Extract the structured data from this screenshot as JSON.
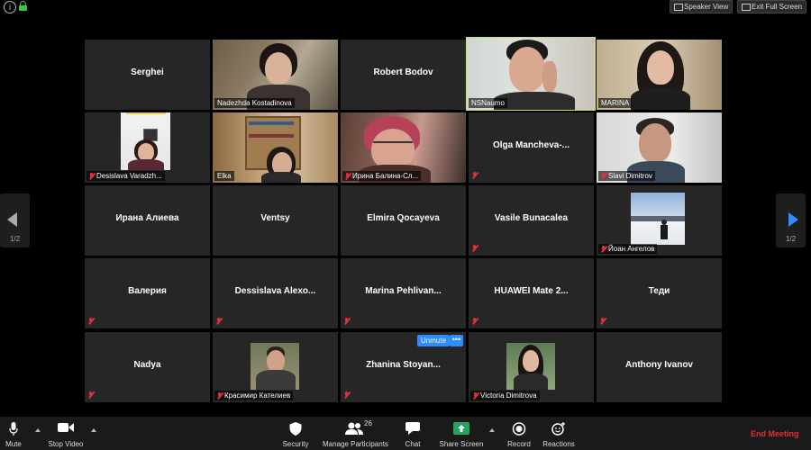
{
  "top_bar": {
    "speaker_view_label": "Speaker View",
    "exit_full_screen_label": "Exit Full Screen"
  },
  "pagination": {
    "left_page": "1/2",
    "right_page": "1/2"
  },
  "tiles": [
    {
      "name": "Serghei",
      "muted": false,
      "video": false
    },
    {
      "name": "Nadezhda Kostadinova",
      "muted": false,
      "video": true
    },
    {
      "name": "Robert Bodov",
      "muted": false,
      "video": false
    },
    {
      "name": "NSNaumo",
      "muted": false,
      "video": true,
      "active_speaker": true
    },
    {
      "name": "MARINA",
      "muted": false,
      "video": true
    },
    {
      "name": "Desislava Varadzh...",
      "muted": true,
      "video": false,
      "photo": true
    },
    {
      "name": "Elka",
      "muted": false,
      "video": true
    },
    {
      "name": "Ирина Балина-Сл...",
      "muted": true,
      "video": true
    },
    {
      "name": "Olga  Mancheva-...",
      "muted": true,
      "video": false
    },
    {
      "name": "Slavi Dimitrov",
      "muted": true,
      "video": true
    },
    {
      "name": "Ирана Алиева",
      "muted": false,
      "video": false
    },
    {
      "name": "Ventsy",
      "muted": false,
      "video": false
    },
    {
      "name": "Elmira Qocayeva",
      "muted": false,
      "video": false
    },
    {
      "name": "Vasile Bunacalea",
      "muted": true,
      "video": false
    },
    {
      "name": "Йоан Ангелов",
      "muted": true,
      "video": false,
      "photo": true
    },
    {
      "name": "Валерия",
      "muted": true,
      "video": false
    },
    {
      "name": "Dessislava  Alexo...",
      "muted": true,
      "video": false
    },
    {
      "name": "Marina  Pehlivan...",
      "muted": true,
      "video": false
    },
    {
      "name": "HUAWEI Mate 2...",
      "muted": true,
      "video": false
    },
    {
      "name": "Теди",
      "muted": true,
      "video": false
    },
    {
      "name": "Nadya",
      "muted": true,
      "video": false
    },
    {
      "name": "Красимир Кателиев",
      "muted": true,
      "video": false,
      "photo": true
    },
    {
      "name": "Zhanina  Stoyan...",
      "muted": true,
      "video": false,
      "hover_actions": true
    },
    {
      "name": "Victoria Dimitrova",
      "muted": true,
      "video": false,
      "photo": true
    },
    {
      "name": "Anthony Ivanov",
      "muted": false,
      "video": false
    }
  ],
  "tile_actions": {
    "unmute_label": "Unmute",
    "more_label": "•••"
  },
  "toolbar": {
    "mute_label": "Mute",
    "stop_video_label": "Stop Video",
    "security_label": "Security",
    "manage_participants_label": "Manage Participants",
    "participant_count": "26",
    "chat_label": "Chat",
    "share_screen_label": "Share Screen",
    "record_label": "Record",
    "reactions_label": "Reactions",
    "end_meeting_label": "End Meeting"
  },
  "colors": {
    "background": "#000000",
    "tile": "#262626",
    "active_speaker_border": "#c8e36c",
    "muted_red": "#e0303c",
    "accent_blue": "#2d8cff",
    "share_green": "#26a35a"
  }
}
